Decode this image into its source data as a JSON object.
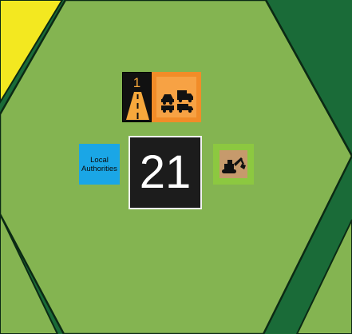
{
  "colors": {
    "background": "#1a6b38",
    "hex_main": "#84b451",
    "hex_side": "#84b451",
    "yellow_region": "#f3e820",
    "dark_green": "#1a6b38",
    "road_tile": "#111111",
    "road_accent": "#f7a83c",
    "vehicles_tile": "#f28c28",
    "authority_tile": "#1aa6e6",
    "score_tile": "#1c1c1c",
    "excavator_tile": "#8cc840",
    "excavator_inner": "#c69a6c"
  },
  "road_tile": {
    "number": "1",
    "icon": "road-icon"
  },
  "vehicles_tile": {
    "icon": "vehicles-icon"
  },
  "authority_tile": {
    "label": "Local\nAuthorities"
  },
  "score_tile": {
    "value": "21"
  },
  "excavator_tile": {
    "icon": "excavator-icon"
  }
}
